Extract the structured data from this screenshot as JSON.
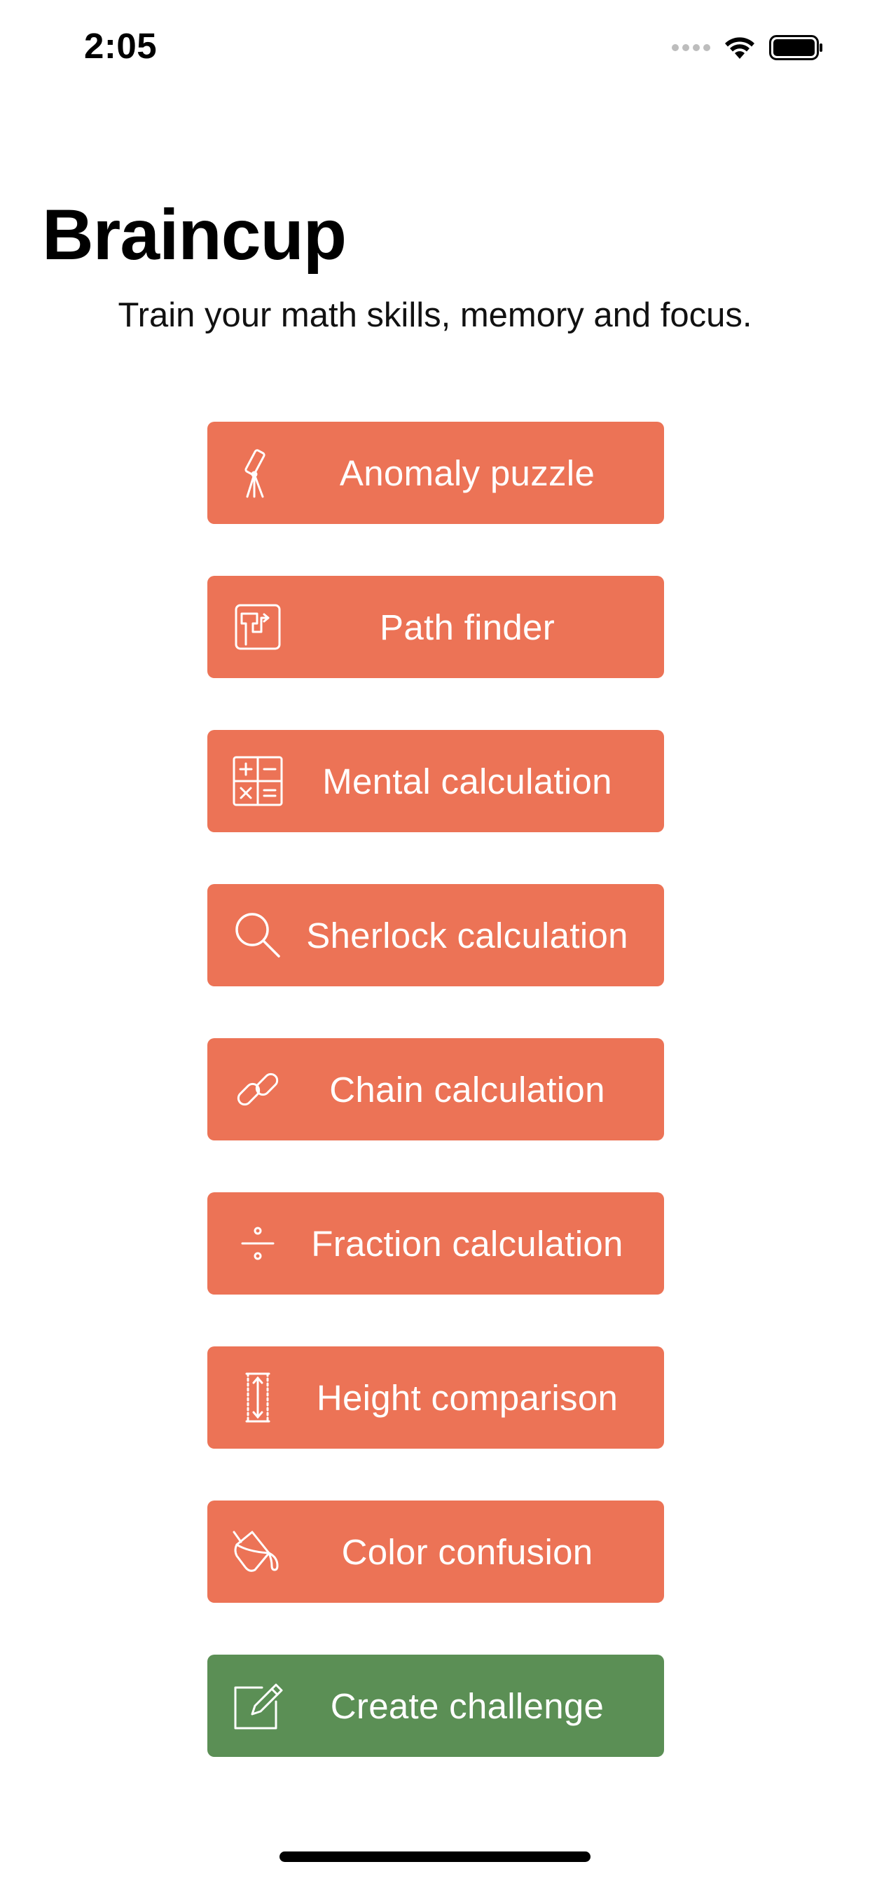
{
  "status_bar": {
    "time": "2:05"
  },
  "header": {
    "title": "Braincup",
    "subtitle": "Train your math skills, memory and focus."
  },
  "menu": {
    "items": [
      {
        "label": "Anomaly puzzle",
        "icon": "telescope-icon"
      },
      {
        "label": "Path finder",
        "icon": "path-icon"
      },
      {
        "label": "Mental calculation",
        "icon": "calculator-icon"
      },
      {
        "label": "Sherlock calculation",
        "icon": "magnifier-icon"
      },
      {
        "label": "Chain calculation",
        "icon": "link-icon"
      },
      {
        "label": "Fraction calculation",
        "icon": "divide-icon"
      },
      {
        "label": "Height comparison",
        "icon": "height-icon"
      },
      {
        "label": "Color confusion",
        "icon": "paint-bucket-icon"
      },
      {
        "label": "Create challenge",
        "icon": "edit-icon"
      }
    ]
  },
  "colors": {
    "game_button": "#ec7356",
    "create_button": "#5b8f55",
    "button_text": "#ffffff"
  }
}
